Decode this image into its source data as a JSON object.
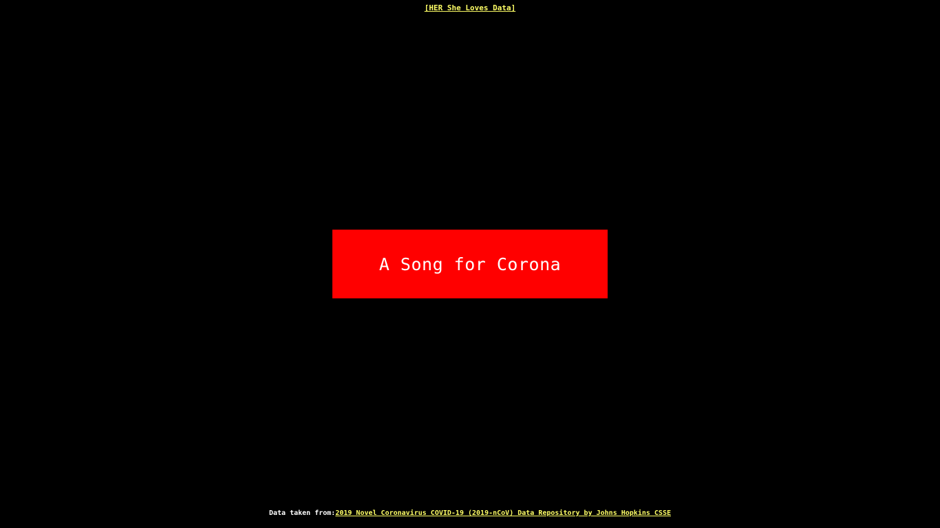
{
  "header": {
    "link_text": "[HER She Loves Data]"
  },
  "main": {
    "title": "A Song for Corona"
  },
  "footer": {
    "prefix": "Data taken from:",
    "link_text": "2019 Novel Coronavirus COVID-19 (2019-nCoV) Data Repository by Johns Hopkins CSSE"
  },
  "colors": {
    "background": "#000000",
    "link": "#ffff66",
    "title_box": "#ff0000",
    "title_text": "#ffffff"
  }
}
